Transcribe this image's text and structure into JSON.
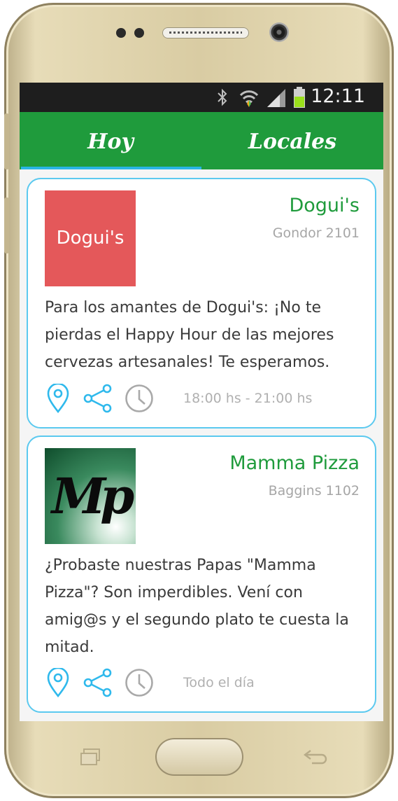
{
  "status_bar": {
    "time": "12:11"
  },
  "tabs": [
    {
      "label": "Hoy",
      "active": true
    },
    {
      "label": "Locales",
      "active": false
    }
  ],
  "colors": {
    "app_bar": "#1f9b3c",
    "accent": "#29b5e5",
    "card_border": "#5bc9ef",
    "title": "#1f9b3c"
  },
  "cards": [
    {
      "logo_text": "Dogui's",
      "name": "Dogui's",
      "address": "Gondor 2101",
      "description": "Para los amantes de Dogui's: ¡No te pierdas el Happy Hour de las mejores cervezas artesanales! Te esperamos.",
      "time": "18:00 hs - 21:00 hs",
      "icons": [
        "location-pin-icon",
        "share-icon",
        "clock-icon"
      ]
    },
    {
      "logo_text": "Mp",
      "name": "Mamma Pizza",
      "address": "Baggins 1102",
      "description": "¿Probaste nuestras Papas \"Mamma Pizza\"? Son imperdibles. Vení con amig@s y el segundo plato te cuesta la mitad.",
      "time": "Todo el día",
      "icons": [
        "location-pin-icon",
        "share-icon",
        "clock-icon"
      ]
    }
  ]
}
